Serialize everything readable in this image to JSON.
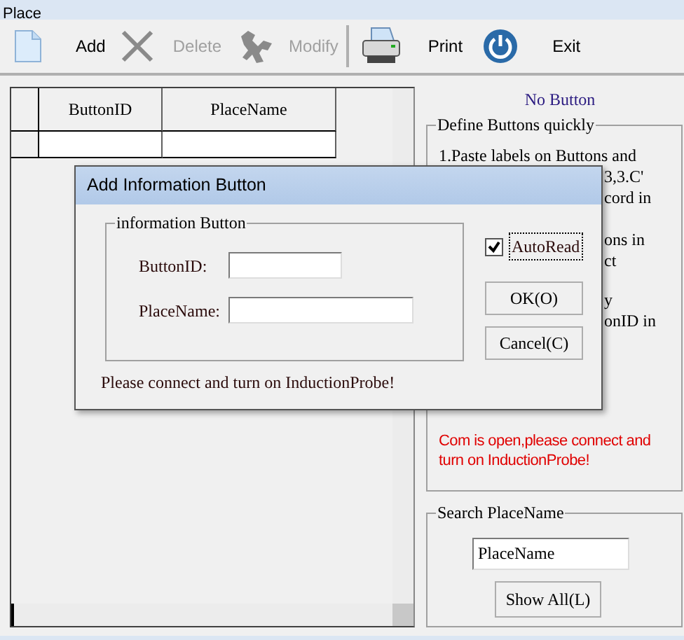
{
  "window": {
    "title": "Place"
  },
  "toolbar": [
    {
      "kind": "icon"
    },
    {
      "kind": "text",
      "label": "Add",
      "disabled": false
    },
    {
      "kind": "icon"
    },
    {
      "kind": "text",
      "label": "Delete",
      "disabled": true
    },
    {
      "kind": "icon"
    },
    {
      "kind": "text",
      "label": "Modify",
      "disabled": true
    },
    {
      "kind": "separator"
    },
    {
      "kind": "icon"
    },
    {
      "kind": "text",
      "label": "Print",
      "disabled": false
    },
    {
      "kind": "icon"
    },
    {
      "kind": "text",
      "label": "Exit",
      "disabled": false
    }
  ],
  "table": {
    "columns": [
      "ButtonID",
      "PlaceName"
    ]
  },
  "status": "No Button",
  "define_group": {
    "title": "Define Buttons quickly",
    "lines": [
      "1.Paste labels on Buttons and",
      "3,3.C'",
      "cord in",
      "ons in",
      "ct",
      "y",
      "onID in"
    ],
    "message": "Com is open,please connect and turn on InductionProbe!"
  },
  "search_group": {
    "title": "Search PlaceName",
    "value": "PlaceName",
    "button": "Show All(L)"
  },
  "dialog": {
    "title": "Add Information Button",
    "group_title": "information Button",
    "fields": [
      {
        "label": "ButtonID:"
      },
      {
        "label": "PlaceName:"
      }
    ],
    "autoread": {
      "label": "AutoRead",
      "checked": true
    },
    "buttons": [
      "OK(O)",
      "Cancel(C)"
    ],
    "message": "Please connect and turn on InductionProbe!"
  }
}
